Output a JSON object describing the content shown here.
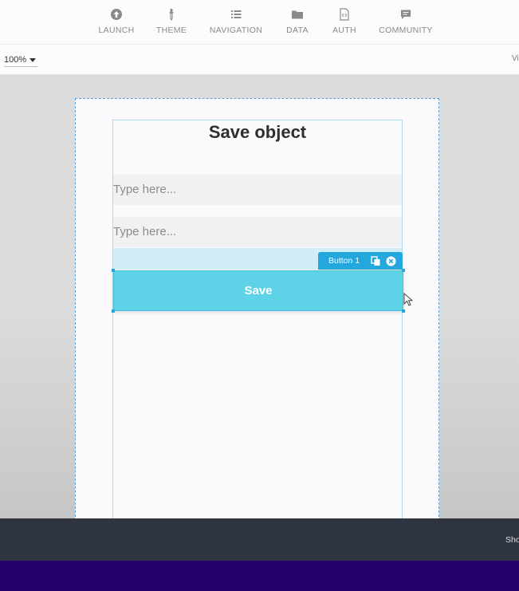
{
  "toolbar": {
    "items": [
      {
        "label": "LAUNCH",
        "icon": "upload-icon"
      },
      {
        "label": "THEME",
        "icon": "dropper-icon"
      },
      {
        "label": "NAVIGATION",
        "icon": "list-icon"
      },
      {
        "label": "DATA",
        "icon": "folder-icon"
      },
      {
        "label": "AUTH",
        "icon": "code-file-icon"
      },
      {
        "label": "COMMUNITY",
        "icon": "chat-icon"
      }
    ]
  },
  "subbar": {
    "zoom": "100%",
    "right_text": "Vi"
  },
  "page": {
    "title": "Save object",
    "inputs": [
      {
        "placeholder": "Type here..."
      },
      {
        "placeholder": "Type here..."
      }
    ],
    "selected_badge": "Button 1",
    "save_button": "Save"
  },
  "bottombar": {
    "text": "Sho"
  },
  "colors": {
    "accent": "#23a7dd",
    "button": "#5ed3e7",
    "footer": "#23006b",
    "bottombar": "#2f3540"
  }
}
